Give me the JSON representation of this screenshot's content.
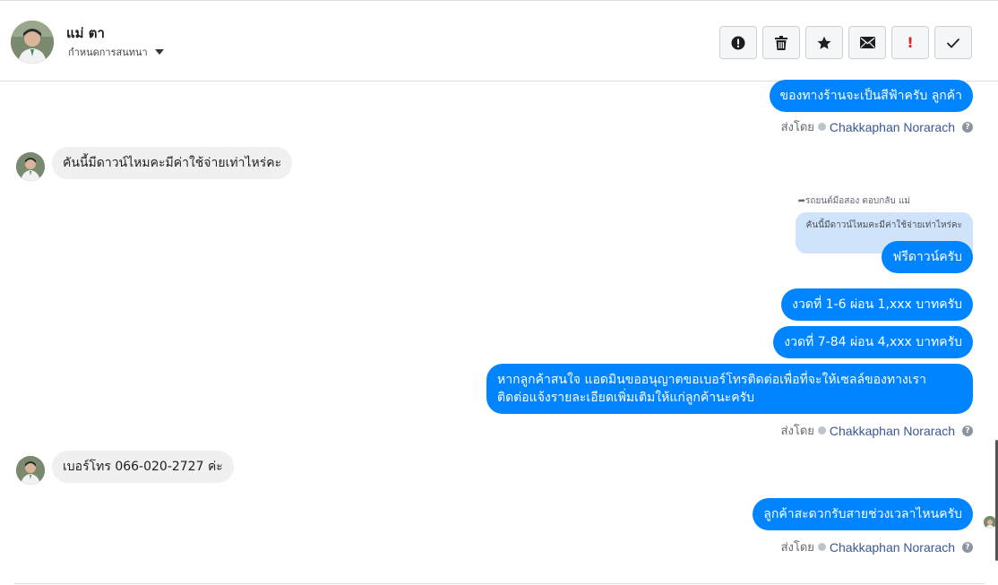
{
  "header": {
    "title": "แม่ ตา",
    "subtitle": "กำหนดการสนทนา",
    "actions": [
      {
        "name": "report-icon",
        "label": "report"
      },
      {
        "name": "trash-icon",
        "label": "delete"
      },
      {
        "name": "star-icon",
        "label": "star"
      },
      {
        "name": "envelope-icon",
        "label": "mark unread"
      },
      {
        "name": "exclamation-icon",
        "label": "important",
        "glyph": "!"
      },
      {
        "name": "check-icon",
        "label": "done"
      }
    ]
  },
  "messages": {
    "out1": "ของทางร้านจะเป็นสีฟ้าครับ ลูกค้า",
    "sent_by_label": "ส่งโดย",
    "sender_name": "Chakkaphan Norarach",
    "in1": "คันนี้มีดาวน์ไหมคะมีค่าใช้จ่ายเท่าไหร่คะ",
    "reply_note": "รถยนต์มือสอง ตอบกลับ แม่",
    "quoted": "คันนี้มีดาวน์ไหมคะมีค่าใช้จ่ายเท่าไหร่คะ",
    "out2": "ฟรีดาวน์ครับ",
    "out3": "งวดที่ 1-6 ผ่อน 1,xxx บาทครับ",
    "out4": "งวดที่ 7-84 ผ่อน 4,xxx บาทครับ",
    "out5": "หากลูกค้าสนใจ แอดมินขออนุญาตขอเบอร์โทรติดต่อเพื่อที่จะให้เซลล์ของทางเรา ติดต่อแจ้งรายละเอียดเพิ่มเติมให้แก่ลูกค้านะครับ",
    "in2": "เบอร์โทร 066-020-2727 ค่ะ",
    "out6": "ลูกค้าสะดวกรับสายช่วงเวลาไหนครับ"
  },
  "colors": {
    "outgoing_bubble": "#0084ff",
    "incoming_bubble": "#f0f0f0",
    "quoted_bubble": "#cfe3fb",
    "sender_link": "#385898",
    "important_red": "#e02020"
  }
}
